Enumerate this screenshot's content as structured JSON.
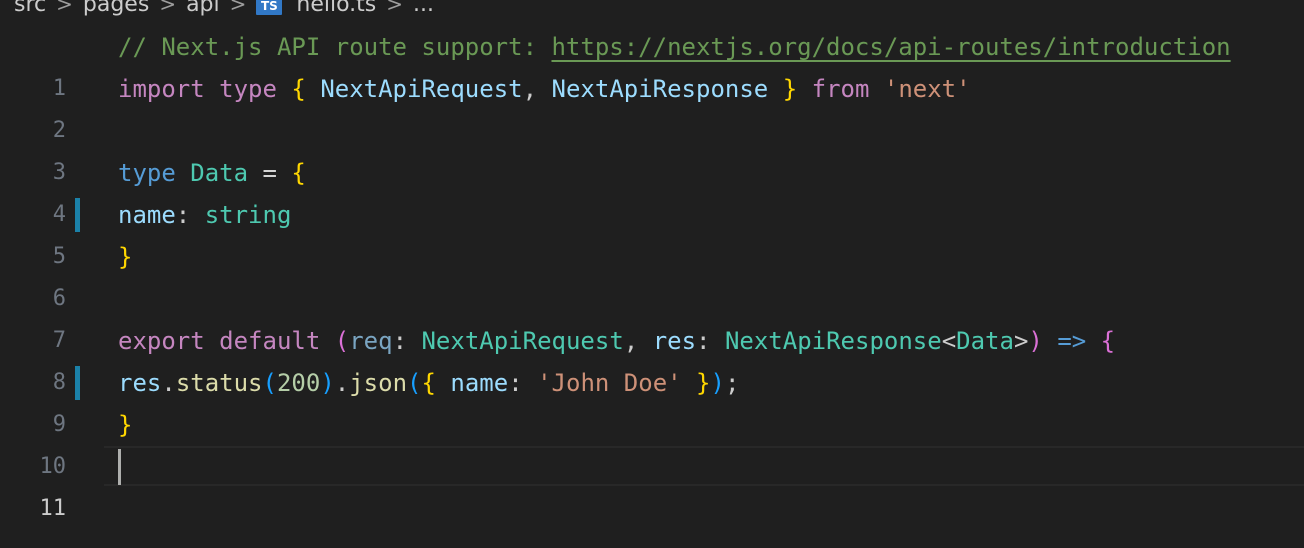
{
  "breadcrumb": {
    "items": [
      "src",
      "pages",
      "api",
      "hello.ts",
      "..."
    ],
    "ts_icon_label": "TS",
    "separator": ">"
  },
  "editor": {
    "line_numbers": [
      "1",
      "2",
      "3",
      "4",
      "5",
      "6",
      "7",
      "8",
      "9",
      "10",
      "11"
    ],
    "current_line": 11,
    "modified_lines": [
      5,
      9
    ],
    "tokens": {
      "l1_comment": "// Next.js API route support: ",
      "l1_link": "https://nextjs.org/docs/api-routes/introduction",
      "l2_import": "import",
      "l2_type": "type",
      "l2_open": "{",
      "l2_req": "NextApiRequest",
      "l2_comma": ",",
      "l2_res": "NextApiResponse",
      "l2_close": "}",
      "l2_from": "from",
      "l2_str": "'next'",
      "l4_type": "type",
      "l4_name": "Data",
      "l4_eq": "=",
      "l4_open": "{",
      "l5_prop": "name",
      "l5_colon": ":",
      "l5_string": "string",
      "l6_close": "}",
      "l8_export": "export",
      "l8_default": "default",
      "l8_paren_open": "(",
      "l8_req": "req",
      "l8_colon1": ":",
      "l8_req_type": "NextApiRequest",
      "l8_comma": ",",
      "l8_res": "res",
      "l8_colon2": ":",
      "l8_res_type": "NextApiResponse",
      "l8_lt": "<",
      "l8_data": "Data",
      "l8_gt": ">",
      "l8_paren_close": ")",
      "l8_arrow": "=>",
      "l8_brace": "{",
      "l9_res": "res",
      "l9_dot1": ".",
      "l9_status": "status",
      "l9_p1": "(",
      "l9_num": "200",
      "l9_p1c": ")",
      "l9_dot2": ".",
      "l9_json": "json",
      "l9_p2": "(",
      "l9_b_open": "{",
      "l9_name": "name",
      "l9_colon": ":",
      "l9_str": "'John Doe'",
      "l9_b_close": "}",
      "l9_p2c": ")",
      "l9_semi": ";",
      "l10_close": "}"
    }
  }
}
